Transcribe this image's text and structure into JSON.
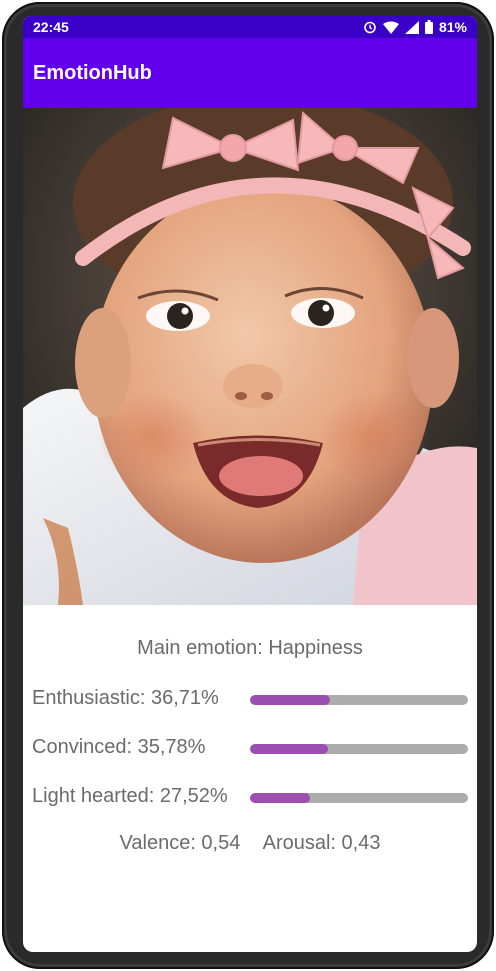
{
  "status_bar": {
    "time": "22:45",
    "battery_percent": "81%",
    "icons": [
      "alarm-icon",
      "wifi-icon",
      "signal-icon",
      "battery-icon"
    ]
  },
  "app_bar": {
    "title": "EmotionHub"
  },
  "results": {
    "main_emotion": "Main emotion: Happiness",
    "emotions": [
      {
        "label": "Enthusiastic: 36,71%",
        "fraction": 0.3671
      },
      {
        "label": "Convinced: 35,78%",
        "fraction": 0.3578
      },
      {
        "label": "Light hearted: 27,52%",
        "fraction": 0.2752
      }
    ],
    "valence": "Valence: 0,54",
    "arousal": "Arousal: 0,43"
  },
  "colors": {
    "status_bar": "#3b00c7",
    "app_bar": "#6200ee",
    "bar_fill": "#9b4fb0",
    "bar_track": "#acacac",
    "text": "#6b6b6b"
  }
}
